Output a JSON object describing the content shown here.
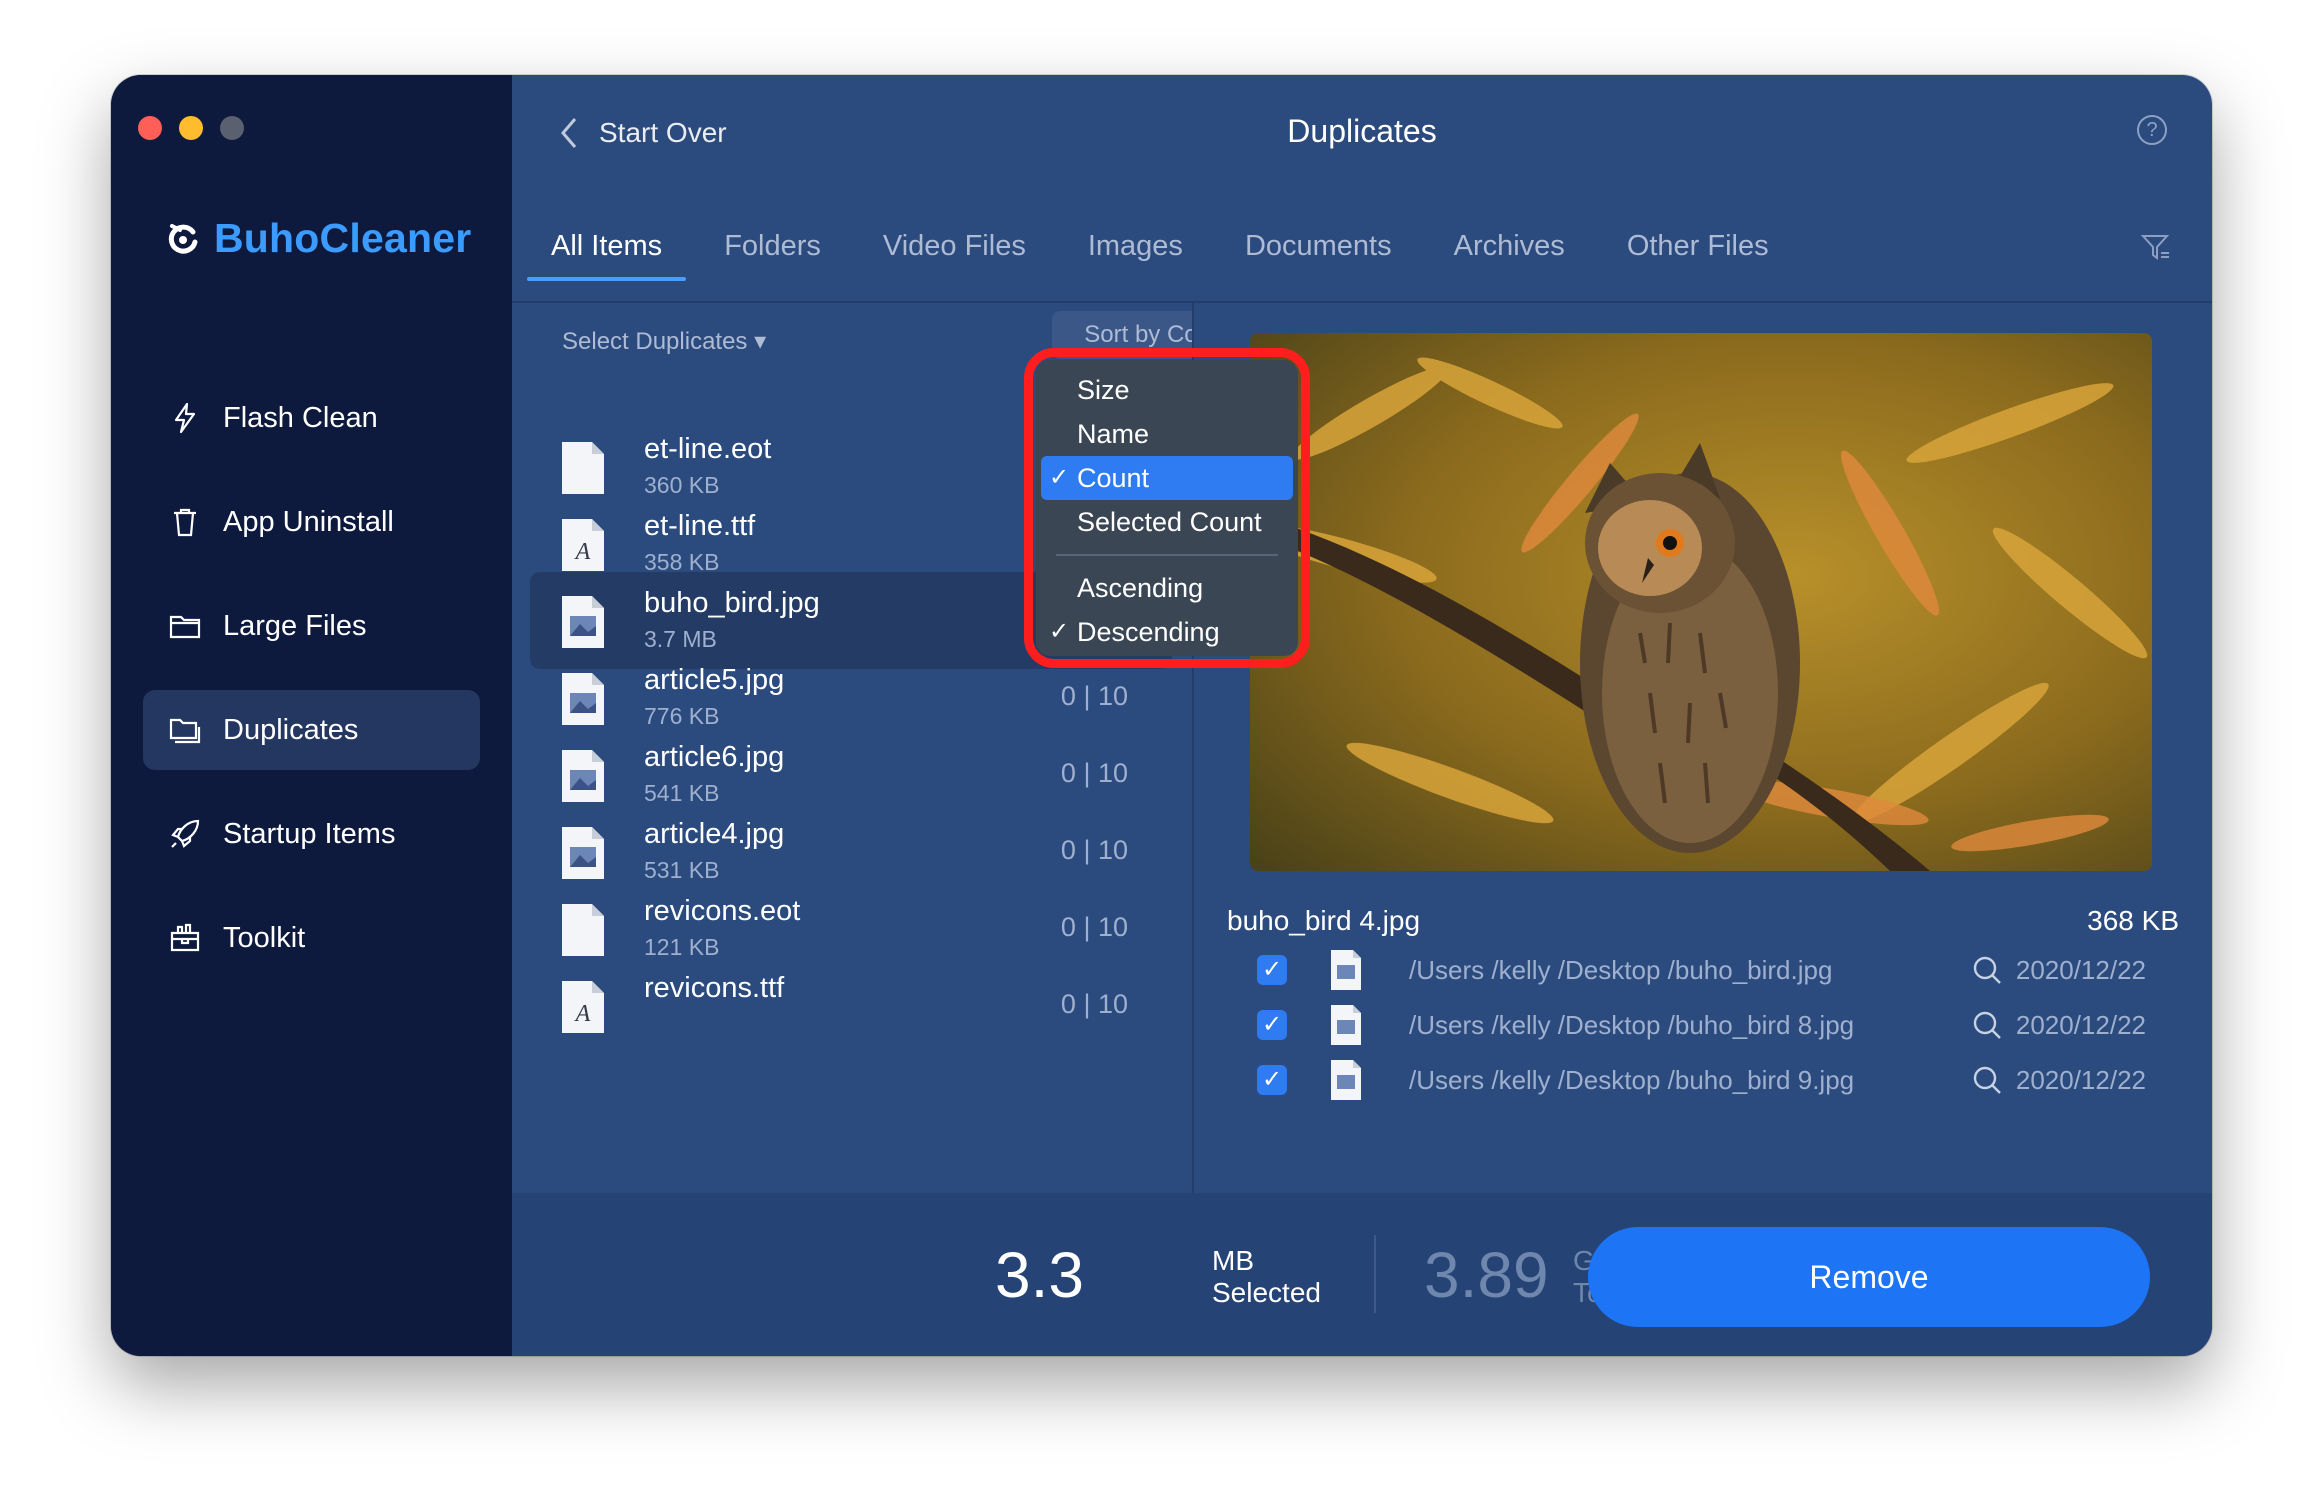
{
  "app": {
    "name": "BuhoCleaner"
  },
  "sidebar": {
    "items": [
      {
        "label": "Flash Clean",
        "icon": "bolt-icon",
        "active": false
      },
      {
        "label": "App Uninstall",
        "icon": "trash-icon",
        "active": false
      },
      {
        "label": "Large Files",
        "icon": "folder-icon",
        "active": false
      },
      {
        "label": "Duplicates",
        "icon": "duplicate-folder-icon",
        "active": true
      },
      {
        "label": "Startup Items",
        "icon": "rocket-icon",
        "active": false
      },
      {
        "label": "Toolkit",
        "icon": "toolbox-icon",
        "active": false
      }
    ]
  },
  "header": {
    "back_label": "Start Over",
    "title": "Duplicates",
    "help": "?"
  },
  "tabs": [
    "All Items",
    "Folders",
    "Video Files",
    "Images",
    "Documents",
    "Archives",
    "Other Files"
  ],
  "list": {
    "select_label": "Select Duplicates ▾",
    "sort_label": "Sort by Count ▾",
    "files": [
      {
        "name": "et-line.eot",
        "size": "360 KB",
        "count": "",
        "type": "blank"
      },
      {
        "name": "et-line.ttf",
        "size": "358 KB",
        "count": "",
        "type": "font"
      },
      {
        "name": "buho_bird.jpg",
        "size": "3.7 MB",
        "count": "",
        "type": "image"
      },
      {
        "name": "article5.jpg",
        "size": "776 KB",
        "count": "0 | 10",
        "type": "image"
      },
      {
        "name": "article6.jpg",
        "size": "541 KB",
        "count": "0 | 10",
        "type": "image"
      },
      {
        "name": "article4.jpg",
        "size": "531 KB",
        "count": "0 | 10",
        "type": "image"
      },
      {
        "name": "revicons.eot",
        "size": "121 KB",
        "count": "0 | 10",
        "type": "blank"
      },
      {
        "name": "revicons.ttf",
        "size": "",
        "count": "0 | 10",
        "type": "font"
      }
    ]
  },
  "sort_menu": {
    "items": [
      {
        "label": "Size",
        "checked": false,
        "highlighted": false
      },
      {
        "label": "Name",
        "checked": false,
        "highlighted": false
      },
      {
        "label": "Count",
        "checked": true,
        "highlighted": true
      },
      {
        "label": "Selected Count",
        "checked": false,
        "highlighted": false
      }
    ],
    "order": [
      {
        "label": "Ascending",
        "checked": false
      },
      {
        "label": "Descending",
        "checked": true
      }
    ]
  },
  "preview": {
    "name": "buho_bird 4.jpg",
    "size": "368 KB",
    "paths": [
      {
        "path": "/Users /kelly /Desktop /buho_bird.jpg",
        "date": "2020/12/22",
        "checked": true
      },
      {
        "path": "/Users /kelly /Desktop /buho_bird 8.jpg",
        "date": "2020/12/22",
        "checked": true
      },
      {
        "path": "/Users /kelly /Desktop /buho_bird 9.jpg",
        "date": "2020/12/22",
        "checked": true
      }
    ]
  },
  "footer": {
    "selected_value": "3.3",
    "selected_unit": "MB",
    "selected_label": "Selected",
    "total_value": "3.89",
    "total_unit": "GB",
    "total_label": "Total",
    "remove_label": "Remove"
  },
  "colors": {
    "accent": "#1d74f5",
    "sidebar": "#0e1a3d",
    "main": "#2b4a7e",
    "highlight_outline": "#ff1e1e"
  }
}
